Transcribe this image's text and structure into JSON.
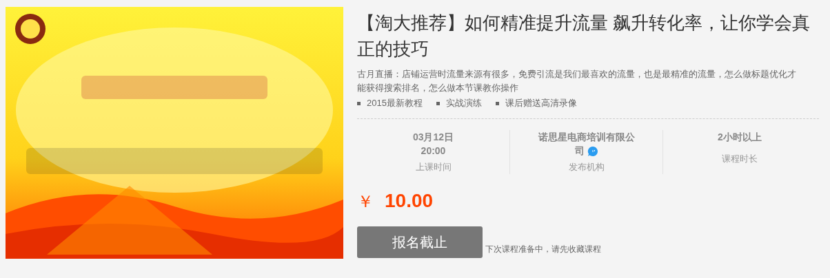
{
  "course": {
    "title": "【淘大推荐】如何精准提升流量 飙升转化率，让你学会真正的技巧",
    "description": "古月直播：店铺运营时流量来源有很多，免费引流是我们最喜欢的流量，也是最精准的流量，怎么做标题优化才能获得搜索排名，怎么做本节课教你操作",
    "features": [
      "2015最新教程",
      "实战演练",
      "课后赠送高清录像"
    ],
    "stats": [
      {
        "kind": "time",
        "value": [
          "03月12日",
          "20:00"
        ],
        "label": "上课时间"
      },
      {
        "kind": "org",
        "value": [
          "诺思星电商培训有限公司"
        ],
        "label": "发布机构"
      },
      {
        "kind": "duration",
        "value": [
          "2小时以上"
        ],
        "label": "课程时长"
      }
    ],
    "price": {
      "currency": "￥",
      "amount": "10.00"
    },
    "signup": {
      "label": "报名截止",
      "disabled": true
    },
    "note": "下次课程准备中，请先收藏课程"
  }
}
